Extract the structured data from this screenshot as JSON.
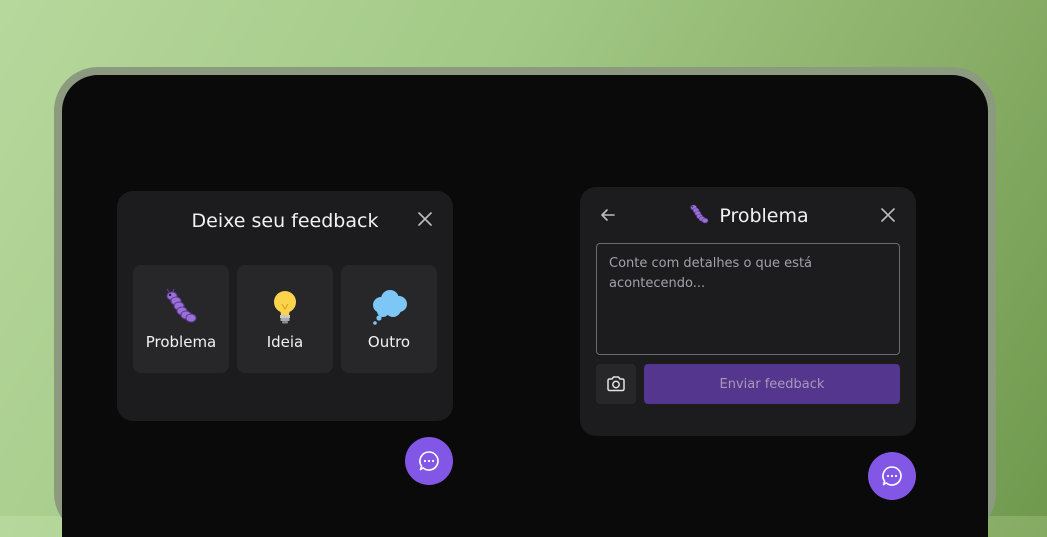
{
  "colors": {
    "brand": "#8257e5",
    "surface": "#1c1c1f",
    "tile": "#27272a"
  },
  "left_widget": {
    "title": "Deixe seu feedback",
    "close_icon": "close-icon",
    "types": [
      {
        "label": "Problema",
        "icon": "bug-icon"
      },
      {
        "label": "Ideia",
        "icon": "lightbulb-icon"
      },
      {
        "label": "Outro",
        "icon": "thought-cloud-icon"
      }
    ]
  },
  "right_widget": {
    "title": "Problema",
    "title_icon": "bug-icon",
    "back_icon": "arrow-left-icon",
    "close_icon": "close-icon",
    "textarea_placeholder": "Conte com detalhes o que está acontecendo...",
    "textarea_value": "",
    "screenshot_icon": "camera-icon",
    "submit_label": "Enviar feedback"
  },
  "fab_icon": "chat-bubble-icon"
}
